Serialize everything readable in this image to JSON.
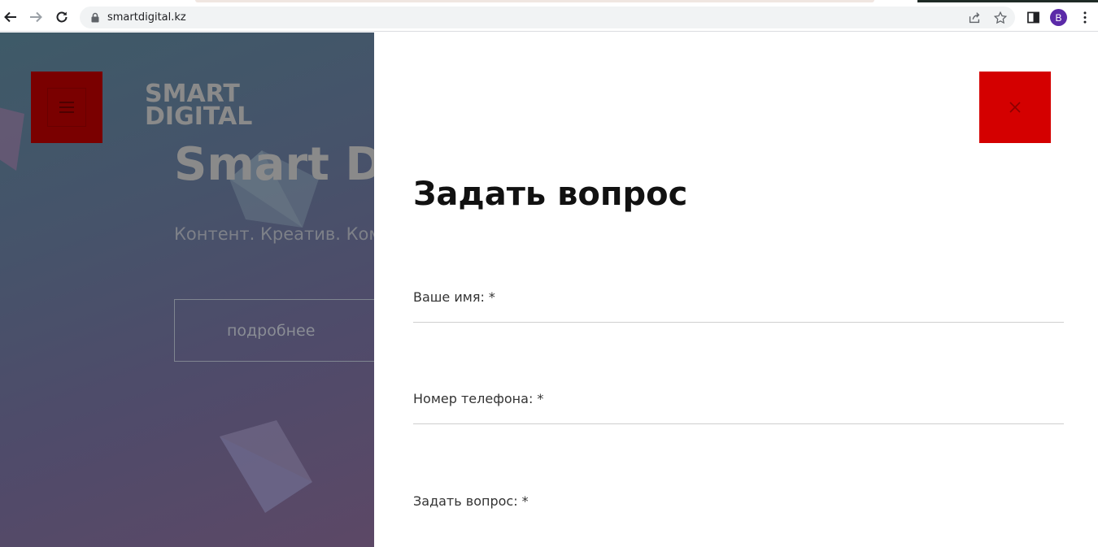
{
  "browser": {
    "url": "smartdigital.kz",
    "profile_initial": "B",
    "icons": [
      "back-arrow-icon",
      "forward-arrow-icon",
      "reload-icon",
      "lock-icon",
      "share-icon",
      "star-icon",
      "side-panel-icon",
      "kebab-menu-icon"
    ]
  },
  "background_page": {
    "logo_line1": "SMART",
    "logo_line2": "DIGITAL",
    "hero_title": "Smart D",
    "hero_subtitle": "Контент. Креатив. Ком",
    "more_button": "подробнее",
    "accent_color": "#7a0000"
  },
  "modal": {
    "title": "Задать вопрос",
    "close_color": "#d40000",
    "fields": [
      {
        "label": "Ваше имя: *"
      },
      {
        "label": "Номер телефона: *"
      },
      {
        "label": "Задать вопрос: *"
      }
    ]
  }
}
